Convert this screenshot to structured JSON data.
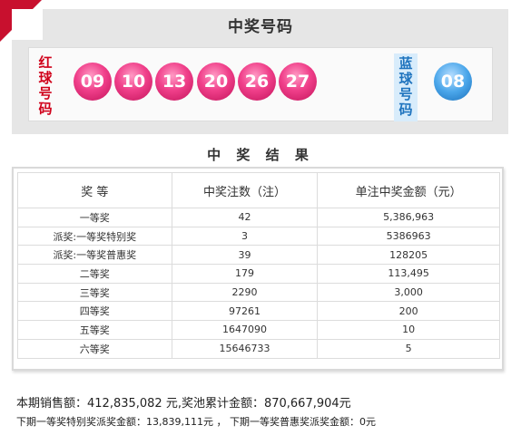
{
  "header": {
    "title": "中奖号码"
  },
  "balls": {
    "red_label": "红球号码",
    "red": [
      "09",
      "10",
      "13",
      "20",
      "26",
      "27"
    ],
    "blue_label": "蓝球号码",
    "blue": [
      "08"
    ]
  },
  "results": {
    "title": "中 奖 结 果",
    "headers": [
      "奖 等",
      "中奖注数（注）",
      "单注中奖金额（元）"
    ],
    "rows": [
      [
        "一等奖",
        "42",
        "5,386,963"
      ],
      [
        "派奖:一等奖特别奖",
        "3",
        "5386963"
      ],
      [
        "派奖:一等奖普惠奖",
        "39",
        "128205"
      ],
      [
        "二等奖",
        "179",
        "113,495"
      ],
      [
        "三等奖",
        "2290",
        "3,000"
      ],
      [
        "四等奖",
        "97261",
        "200"
      ],
      [
        "五等奖",
        "1647090",
        "10"
      ],
      [
        "六等奖",
        "15646733",
        "5"
      ]
    ]
  },
  "footer": {
    "sales": "本期销售额：412,835,082 元,奖池累计金额：870,667,904元",
    "next_draw": "下期一等奖特别奖派奖金额：13,839,111元 ，  下期一等奖普惠奖派奖金额：0元"
  },
  "colors": {
    "red_ball": "#f03f8a",
    "blue_ball": "#4aa6ea",
    "corner": "#c8102e"
  }
}
